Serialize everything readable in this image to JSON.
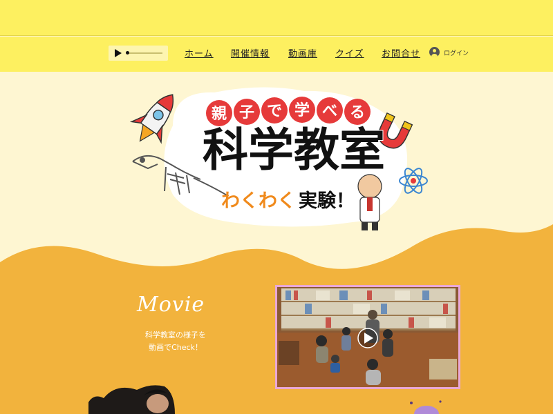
{
  "nav": {
    "items": [
      "ホーム",
      "開催情報",
      "動画庫",
      "クイズ",
      "お問合せ"
    ],
    "login_label": "ログイン"
  },
  "hero": {
    "tagline_chars": [
      "親",
      "子",
      "で",
      "学",
      "べ",
      "る"
    ],
    "title": "科学教室",
    "subtitle_orange": "わくわく",
    "subtitle_black": "実験！"
  },
  "movie": {
    "heading": "Movie",
    "desc_line1": "科学教室の様子を",
    "desc_line2": "動画でCheck！"
  },
  "colors": {
    "nav_yellow": "#fdf060",
    "cream": "#fef6d2",
    "orange": "#f2b33d",
    "tagline_red": "#e63a3a",
    "subtitle_orange": "#f08a1c"
  },
  "icons": [
    "play-icon",
    "user-icon",
    "play-circle-icon",
    "rocket-icon",
    "magnet-icon",
    "atom-icon",
    "dinosaur-icon"
  ]
}
